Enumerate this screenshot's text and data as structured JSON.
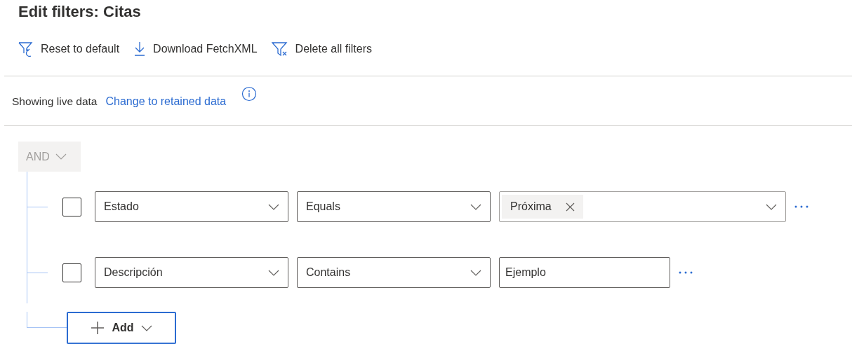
{
  "title": "Edit filters: Citas",
  "toolbar": [
    {
      "kind": "reset",
      "label": "Reset to default"
    },
    {
      "kind": "download",
      "label": "Download FetchXML"
    },
    {
      "kind": "delete",
      "label": "Delete all filters"
    }
  ],
  "data_source": {
    "status": "Showing live data",
    "link": "Change to retained data"
  },
  "group": {
    "operator": "AND",
    "disabled": true
  },
  "conditions": [
    {
      "checked": false,
      "field": "Estado",
      "operator": "Equals",
      "value": {
        "kind": "tags",
        "tags": [
          "Próxima"
        ]
      }
    },
    {
      "checked": false,
      "field": "Descripción",
      "operator": "Contains",
      "value": {
        "kind": "text",
        "text": "Ejemplo"
      }
    }
  ],
  "add_button": "Add"
}
